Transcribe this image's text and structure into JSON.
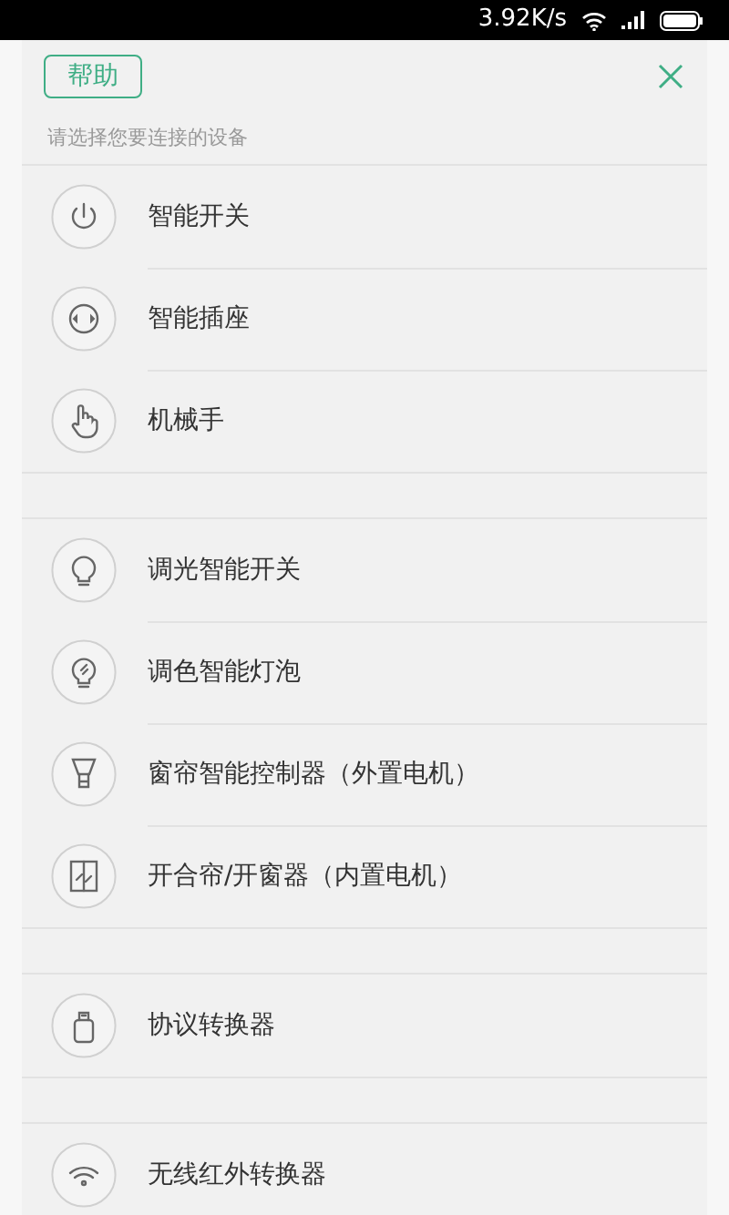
{
  "status_bar": {
    "speed": "3.92K/s"
  },
  "header": {
    "help_button": "帮助"
  },
  "prompt": "请选择您要连接的设备",
  "groups": [
    {
      "items": [
        {
          "label": "智能开关",
          "kind": "power"
        },
        {
          "label": "智能插座",
          "kind": "socket"
        },
        {
          "label": "机械手",
          "kind": "hand"
        }
      ]
    },
    {
      "items": [
        {
          "label": "调光智能开关",
          "kind": "bulb"
        },
        {
          "label": "调色智能灯泡",
          "kind": "colorbulb"
        },
        {
          "label": "窗帘智能控制器（外置电机）",
          "kind": "curtain"
        },
        {
          "label": "开合帘/开窗器（内置电机）",
          "kind": "window"
        }
      ]
    },
    {
      "items": [
        {
          "label": "协议转换器",
          "kind": "converter"
        }
      ]
    },
    {
      "items": [
        {
          "label": "无线红外转换器",
          "kind": "wifi"
        }
      ]
    }
  ]
}
